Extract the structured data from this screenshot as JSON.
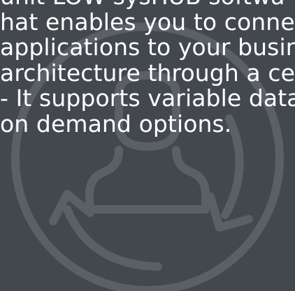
{
  "colors": {
    "background": "#43484e",
    "emblem_stroke": "#5b6066",
    "text": "#ffffff"
  },
  "emblem": {
    "icon": "user-cycle-icon"
  },
  "text_block": {
    "lines": [
      "unit LOW sysHUB softwa",
      "hat enables you to conne",
      "applications to your busin",
      "architecture through a ce",
      "- It supports variable data",
      "on demand options."
    ]
  }
}
